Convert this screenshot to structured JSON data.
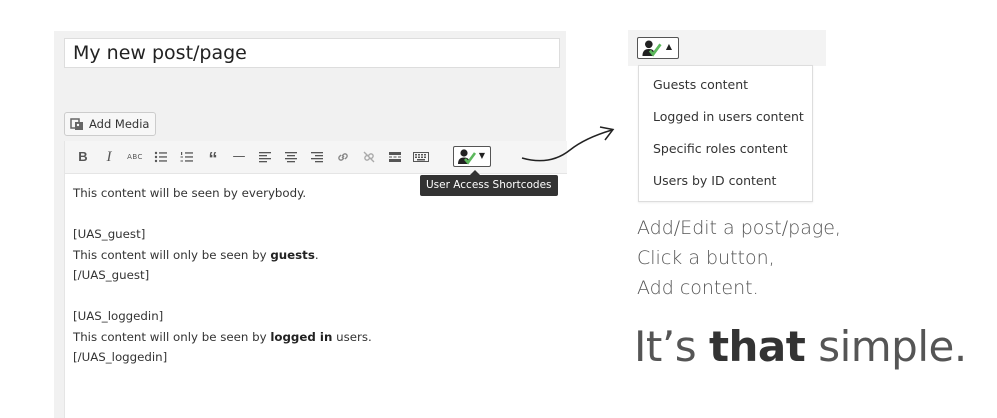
{
  "editor": {
    "title_value": "My new post/page",
    "add_media_label": "Add Media",
    "toolbar": {
      "bold": "B",
      "italic": "I",
      "strike": "ABC",
      "blockquote": "“",
      "hr": "—"
    },
    "tooltip": "User Access Shortcodes",
    "content": {
      "l1": "This content will be seen by everybody.",
      "l2": "[UAS_guest]",
      "l3_pre": "This content will only be seen by ",
      "l3_bold": "guests",
      "l3_post": ".",
      "l4": "[/UAS_guest]",
      "l5": "[UAS_loggedin]",
      "l6_pre": "This content will only be seen by ",
      "l6_bold": "logged in",
      "l6_post": " users.",
      "l7": "[/UAS_loggedin]"
    }
  },
  "dropdown": {
    "items": [
      "Guests content",
      "Logged in users content",
      "Specific roles content",
      "Users by ID content"
    ]
  },
  "steps": [
    "Add/Edit a post/page,",
    "Click a button,",
    "Add content."
  ],
  "tagline": {
    "pre": "It’s ",
    "bold": "that",
    "post": " simple."
  },
  "icons": {
    "uas": "user-check-icon",
    "add_media": "media-icon",
    "arrow": "curved-arrow-icon"
  },
  "colors": {
    "uas_check": "#5cb85c",
    "user_silhouette": "#222222"
  }
}
